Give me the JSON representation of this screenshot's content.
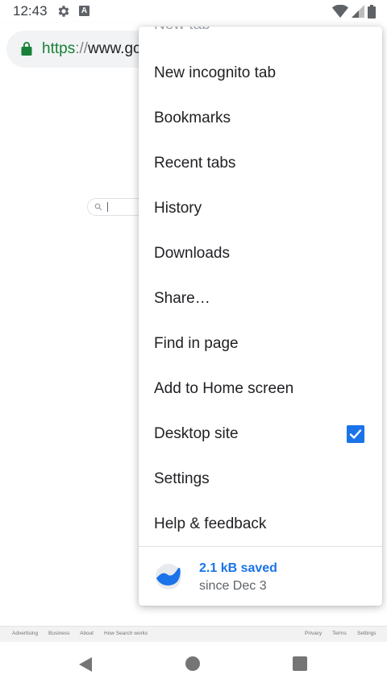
{
  "status_bar": {
    "time": "12:43",
    "icons": [
      "gear-icon",
      "a-badge-icon",
      "wifi-icon",
      "cell-signal-icon",
      "battery-icon"
    ],
    "a_badge_text": "A"
  },
  "toolbar": {
    "url_scheme": "https",
    "url_separator": "://",
    "url_host": "www.gc",
    "lock_color": "#188038"
  },
  "page": {
    "footer_left": [
      "Advertising",
      "Business",
      "About",
      "How Search works"
    ],
    "footer_right": [
      "Privacy",
      "Terms",
      "Settings"
    ]
  },
  "menu": {
    "items": [
      {
        "label": "New tab"
      },
      {
        "label": "New incognito tab"
      },
      {
        "label": "Bookmarks"
      },
      {
        "label": "Recent tabs"
      },
      {
        "label": "History"
      },
      {
        "label": "Downloads"
      },
      {
        "label": "Share…"
      },
      {
        "label": "Find in page"
      },
      {
        "label": "Add to Home screen"
      },
      {
        "label": "Desktop site",
        "checked": true
      },
      {
        "label": "Settings"
      },
      {
        "label": "Help & feedback"
      }
    ],
    "data_saver": {
      "saved": "2.1 kB saved",
      "since": "since Dec 3"
    }
  },
  "colors": {
    "accent": "#1a73e8",
    "secure_green": "#188038"
  }
}
